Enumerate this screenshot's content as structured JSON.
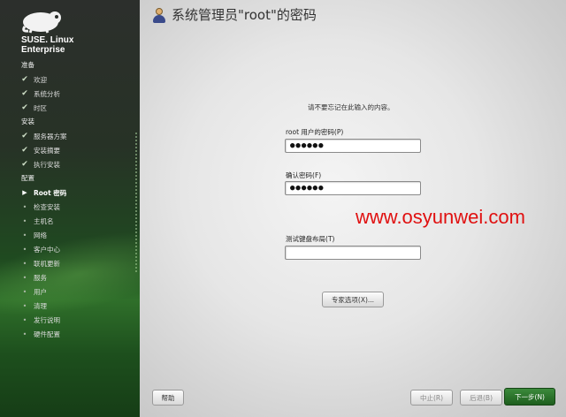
{
  "sidebar": {
    "brand_line1": "SUSE. Linux",
    "brand_line2": "Enterprise",
    "sections": [
      {
        "label": "准备",
        "items": [
          {
            "label": "欢迎",
            "state": "done"
          },
          {
            "label": "系统分析",
            "state": "done"
          },
          {
            "label": "时区",
            "state": "done"
          }
        ]
      },
      {
        "label": "安装",
        "items": [
          {
            "label": "服务器方案",
            "state": "done"
          },
          {
            "label": "安装摘要",
            "state": "done"
          },
          {
            "label": "执行安装",
            "state": "done"
          }
        ]
      },
      {
        "label": "配置",
        "items": [
          {
            "label": "Root 密码",
            "state": "current"
          },
          {
            "label": "检查安装",
            "state": "pending"
          },
          {
            "label": "主机名",
            "state": "pending"
          },
          {
            "label": "网络",
            "state": "pending"
          },
          {
            "label": "客户中心",
            "state": "pending"
          },
          {
            "label": "联机更新",
            "state": "pending"
          },
          {
            "label": "服务",
            "state": "pending"
          },
          {
            "label": "用户",
            "state": "pending"
          },
          {
            "label": "清理",
            "state": "pending"
          },
          {
            "label": "发行说明",
            "state": "pending"
          },
          {
            "label": "硬件配置",
            "state": "pending"
          }
        ]
      }
    ]
  },
  "main": {
    "title": "系统管理员\"root\"的密码",
    "hint": "请不要忘记在此输入的内容。",
    "password_label": "root 用户的密码",
    "password_accel": "P",
    "password_value": "●●●●●●",
    "confirm_label": "确认密码",
    "confirm_accel": "F",
    "confirm_value": "●●●●●●",
    "keyboard_label": "测试键盘布局",
    "keyboard_accel": "T",
    "keyboard_value": "",
    "expert_button": "专家选项(X)...",
    "watermark": "www.osyunwei.com"
  },
  "footer": {
    "help": "帮助",
    "abort": "中止(R)",
    "back": "后退(B)",
    "next": "下一步(N)"
  }
}
